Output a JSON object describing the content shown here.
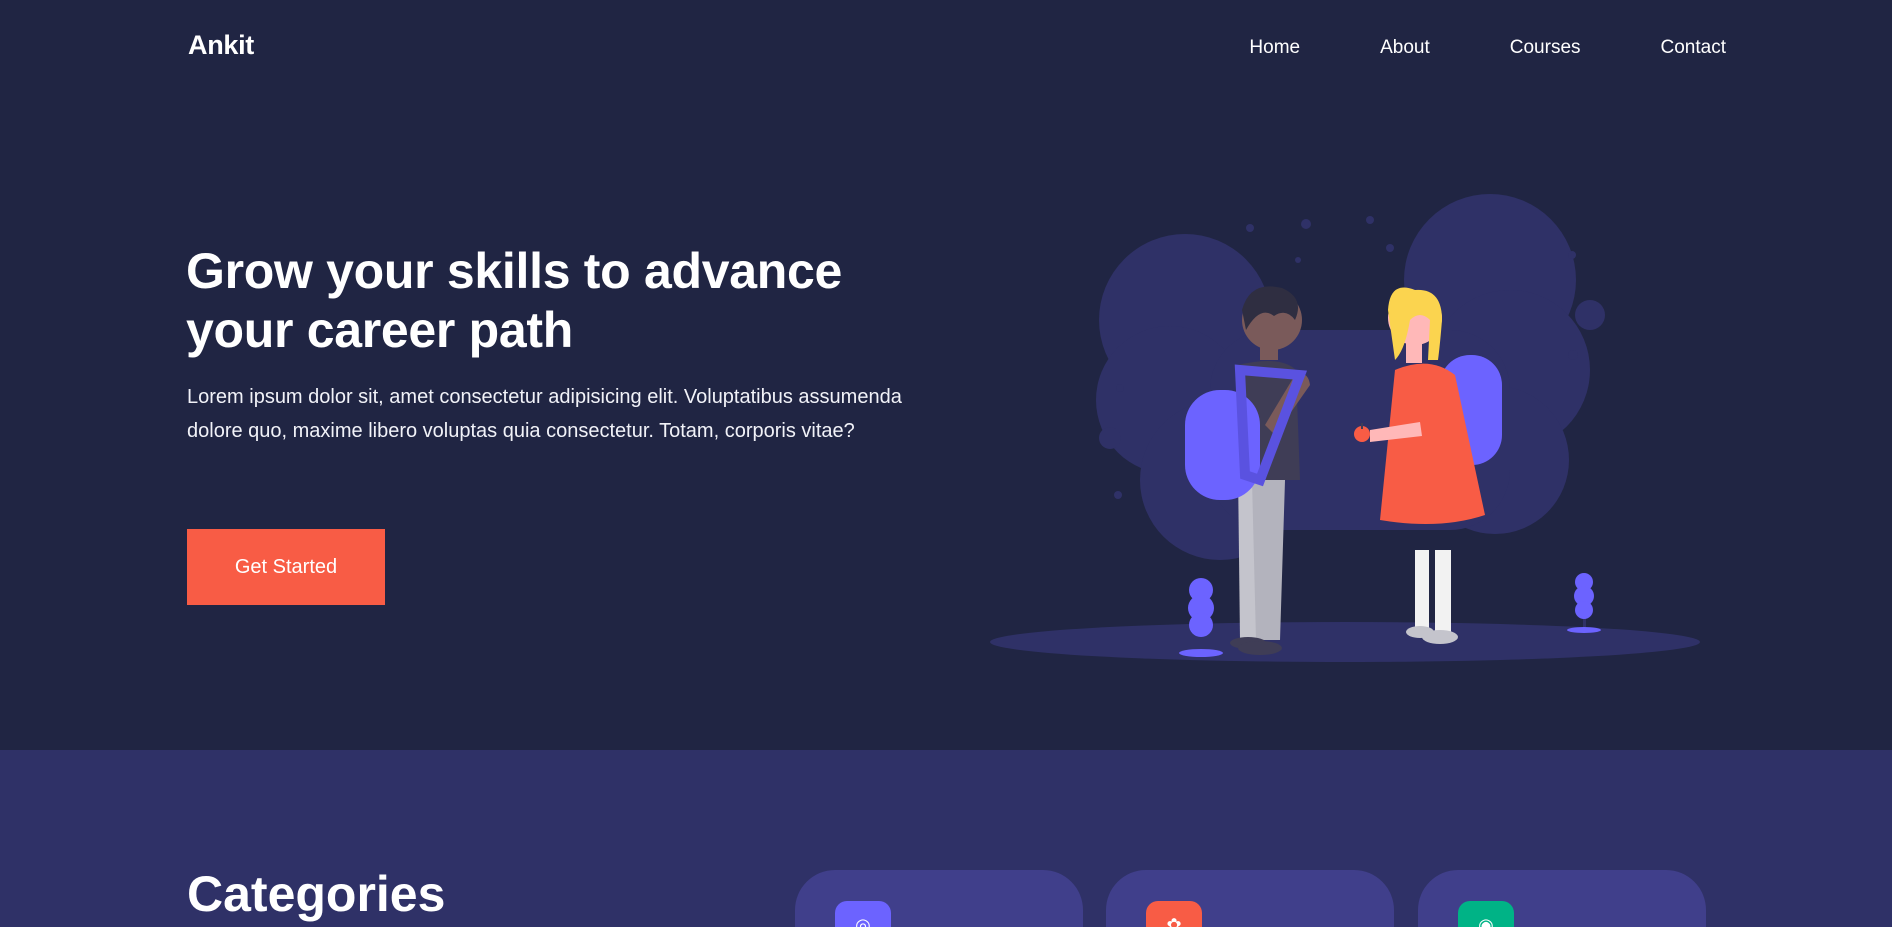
{
  "brand": {
    "name": "Ankit"
  },
  "nav": {
    "items": [
      "Home",
      "About",
      "Courses",
      "Contact"
    ]
  },
  "hero": {
    "title": "Grow your skills to advance your career path",
    "description": "Lorem ipsum dolor sit, amet consectetur adipisicing elit. Voluptatibus assumenda dolore quo, maxime libero voluptas quia consectetur. Totam, corporis vitae?",
    "cta_label": "Get Started",
    "illustration": "kids-with-backpacks-illustration"
  },
  "categories": {
    "title": "Categories",
    "cards": [
      {
        "icon": "eye-icon",
        "color": "#6c63ff"
      },
      {
        "icon": "palette-icon",
        "color": "#f85c45"
      },
      {
        "icon": "dollar-icon",
        "color": "#00b386"
      }
    ]
  },
  "colors": {
    "background": "#202543",
    "section": "#2f3167",
    "card": "#403f8b",
    "accent": "#f85c45",
    "illustration_purple": "#6c63ff"
  }
}
